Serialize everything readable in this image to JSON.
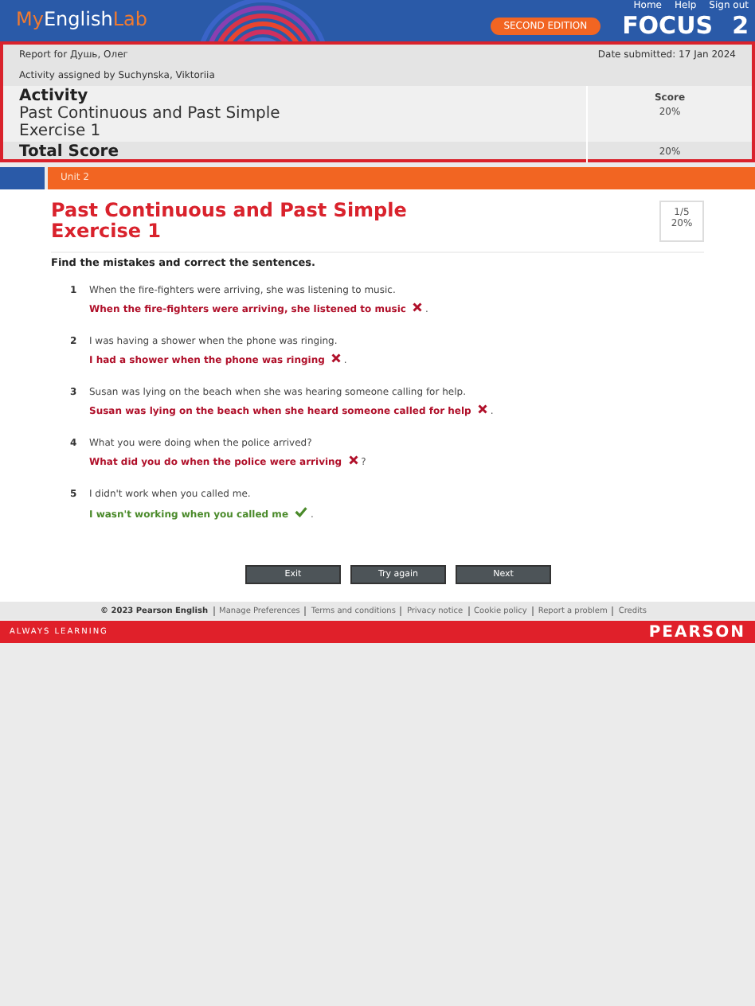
{
  "header": {
    "logo": [
      {
        "text": "My",
        "accent": true
      },
      {
        "text": "English",
        "accent": false
      },
      {
        "text": "Lab",
        "accent": true
      }
    ],
    "nav": [
      "Home",
      "Help",
      "Sign out"
    ],
    "edition": "SECOND EDITION",
    "brand": "FOCUS",
    "brand_level": "2"
  },
  "report": {
    "report_for": "Report for Душь, Олег",
    "date": "Date submitted: 17 Jan 2024",
    "assigned": "Activity assigned by Suchynska, Viktoriia",
    "activity_heading": "Activity",
    "score_heading": "Score",
    "activity_name": [
      "Past Continuous and Past Simple",
      "Exercise 1"
    ],
    "activity_score": "20%",
    "total_label": "Total Score",
    "total_score": "20%"
  },
  "unit": "Unit 2",
  "exercise": {
    "title": [
      "Past Continuous and Past Simple",
      "Exercise 1"
    ],
    "progress": "1/5",
    "percent": "20%",
    "instruction": "Find the mistakes and correct the sentences.",
    "items": [
      {
        "number": "1",
        "question": "When the fire-fighters were arriving, she was listening to music.",
        "answer": "When the fire-fighters were arriving, she listened to music",
        "correct": false,
        "end": "."
      },
      {
        "number": "2",
        "question": "I was having a shower when the phone was ringing.",
        "answer": "I had a shower when the phone was ringing",
        "correct": false,
        "end": "."
      },
      {
        "number": "3",
        "question": "Susan was lying on the beach when she was hearing someone calling for help.",
        "answer": "Susan was lying on the beach when she heard someone called for help",
        "correct": false,
        "end": "."
      },
      {
        "number": "4",
        "question": "What you were doing when the police arrived?",
        "answer": "What did you do when the police were arriving",
        "correct": false,
        "end": "?"
      },
      {
        "number": "5",
        "question": "I didn't work when you called me.",
        "answer": "I wasn't working when you called me",
        "correct": true,
        "end": "."
      }
    ]
  },
  "buttons": [
    "Exit",
    "Try again",
    "Next"
  ],
  "footer": {
    "links": [
      "© 2023 Pearson English",
      "Manage Preferences",
      "Terms and conditions",
      "Privacy notice",
      "Cookie policy",
      "Report a problem",
      "Credits"
    ],
    "tagline": "ALWAYS LEARNING",
    "company": "PEARSON"
  }
}
